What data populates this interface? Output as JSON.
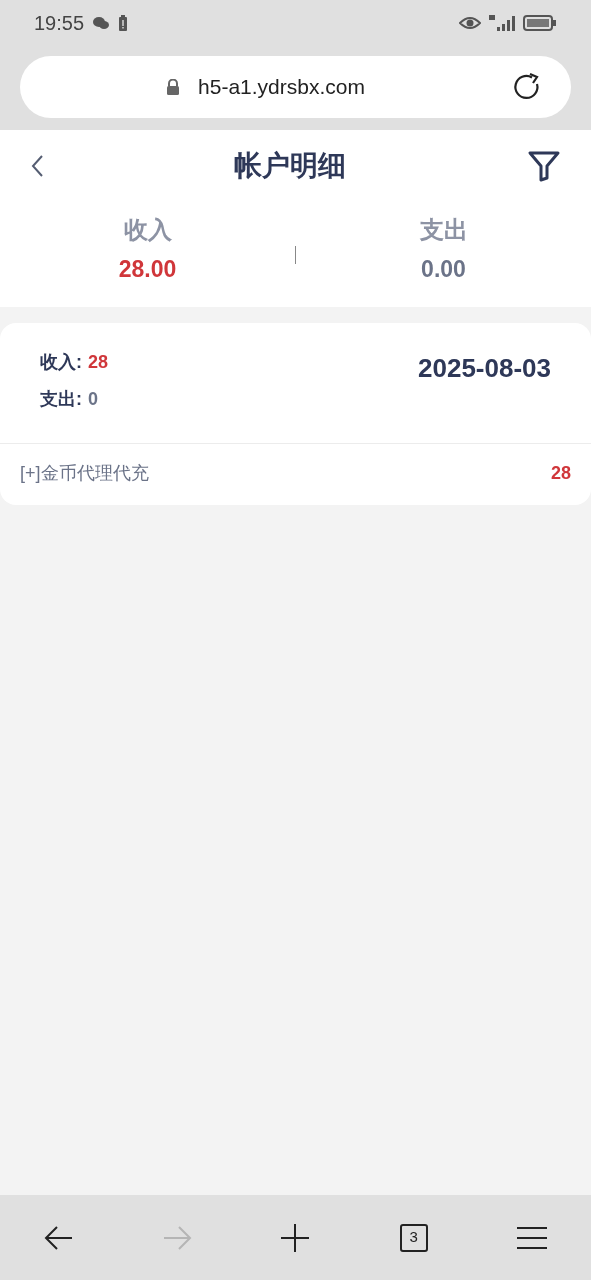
{
  "status_bar": {
    "time": "19:55"
  },
  "browser": {
    "url": "h5-a1.ydrsbx.com"
  },
  "header": {
    "title": "帐户明细"
  },
  "summary": [
    {
      "label": "收入",
      "value": "28.00",
      "kind": "income"
    },
    {
      "label": "支出",
      "value": "0.00",
      "kind": "expense"
    }
  ],
  "days": [
    {
      "income_label": "收入:",
      "income": "28",
      "expense_label": "支出:",
      "expense": "0",
      "date": "2025-08-03",
      "entries": [
        {
          "description": "[+]金币代理代充",
          "amount": "28"
        }
      ]
    }
  ],
  "bottom_bar": {
    "back_disabled": false,
    "forward_disabled": true,
    "tab_count": "3"
  }
}
